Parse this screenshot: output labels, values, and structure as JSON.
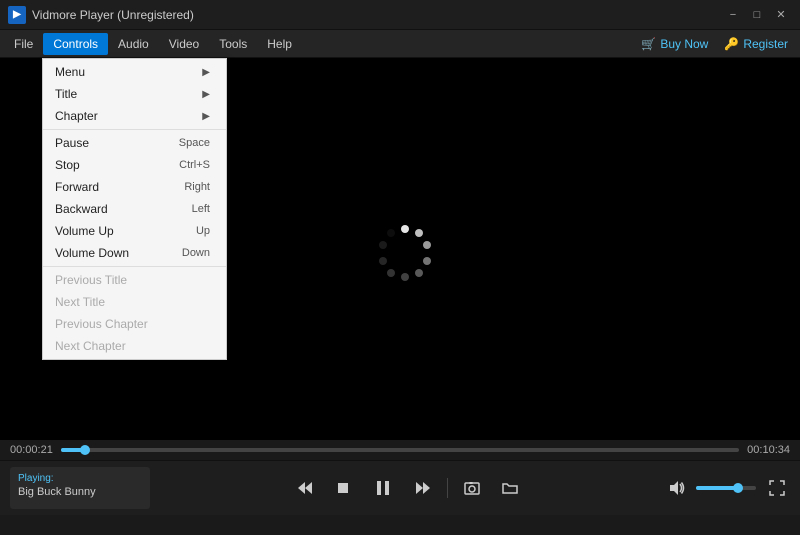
{
  "titleBar": {
    "appName": "Vidmore Player (Unregistered)",
    "minimize": "−",
    "maximize": "□",
    "close": "✕"
  },
  "menuBar": {
    "items": [
      {
        "id": "file",
        "label": "File"
      },
      {
        "id": "controls",
        "label": "Controls",
        "active": true
      },
      {
        "id": "audio",
        "label": "Audio"
      },
      {
        "id": "video",
        "label": "Video"
      },
      {
        "id": "tools",
        "label": "Tools"
      },
      {
        "id": "help",
        "label": "Help"
      }
    ],
    "buyNow": "Buy Now",
    "register": "Register"
  },
  "controlsMenu": {
    "items": [
      {
        "id": "menu",
        "label": "Menu",
        "shortcut": "",
        "hasArrow": true,
        "disabled": false
      },
      {
        "id": "title",
        "label": "Title",
        "shortcut": "",
        "hasArrow": true,
        "disabled": false
      },
      {
        "id": "chapter",
        "label": "Chapter",
        "shortcut": "",
        "hasArrow": true,
        "disabled": false
      },
      {
        "separator": true
      },
      {
        "id": "pause",
        "label": "Pause",
        "shortcut": "Space",
        "hasArrow": false,
        "disabled": false
      },
      {
        "id": "stop",
        "label": "Stop",
        "shortcut": "Ctrl+S",
        "hasArrow": false,
        "disabled": false
      },
      {
        "id": "forward",
        "label": "Forward",
        "shortcut": "Right",
        "hasArrow": false,
        "disabled": false
      },
      {
        "id": "backward",
        "label": "Backward",
        "shortcut": "Left",
        "hasArrow": false,
        "disabled": false
      },
      {
        "id": "volume-up",
        "label": "Volume Up",
        "shortcut": "Up",
        "hasArrow": false,
        "disabled": false
      },
      {
        "id": "volume-down",
        "label": "Volume Down",
        "shortcut": "Down",
        "hasArrow": false,
        "disabled": false
      },
      {
        "separator2": true
      },
      {
        "id": "prev-title",
        "label": "Previous Title",
        "shortcut": "",
        "hasArrow": false,
        "disabled": true
      },
      {
        "id": "next-title",
        "label": "Next Title",
        "shortcut": "",
        "hasArrow": false,
        "disabled": true
      },
      {
        "id": "prev-chapter",
        "label": "Previous Chapter",
        "shortcut": "",
        "hasArrow": false,
        "disabled": true
      },
      {
        "id": "next-chapter",
        "label": "Next Chapter",
        "shortcut": "",
        "hasArrow": false,
        "disabled": true
      }
    ]
  },
  "player": {
    "currentTime": "00:00:21",
    "totalTime": "00:10:34",
    "progressPercent": 3.5,
    "volumePercent": 70
  },
  "nowPlaying": {
    "label": "Playing:",
    "title": "Big Buck Bunny"
  }
}
